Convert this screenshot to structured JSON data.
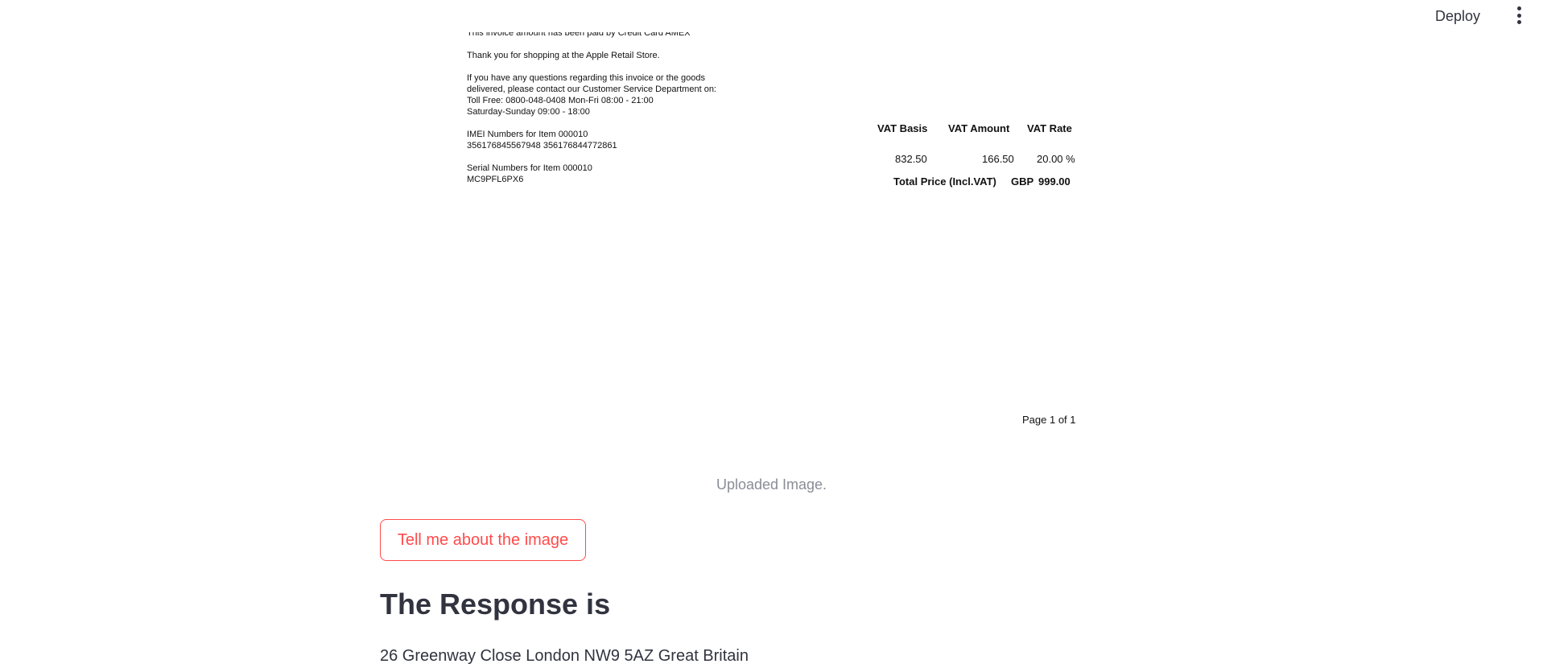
{
  "header": {
    "deploy_label": "Deploy",
    "menu_icon": "vertical-ellipsis-icon"
  },
  "invoice": {
    "notes": [
      "This invoice amount has been paid by Credit Card AMEX",
      "Thank you for shopping at the Apple Retail Store.",
      "If you have any questions regarding this invoice or the goods\ndelivered, please contact our Customer Service Department on:\nToll Free: 0800-048-0408 Mon-Fri 08:00 - 21:00\nSaturday-Sunday 09:00 - 18:00",
      "IMEI Numbers for Item 000010\n356176845567948 356176844772861",
      "Serial Numbers for Item 000010\nMC9PFL6PX6"
    ],
    "vat": {
      "headers": [
        "VAT Basis",
        "VAT Amount",
        "VAT Rate"
      ],
      "values": [
        "832.50",
        "166.50",
        "20.00 %"
      ],
      "total_label": "Total Price (Incl.VAT)",
      "currency": "GBP",
      "total_value": "999.00"
    },
    "page_label": "Page 1 of 1"
  },
  "caption": "Uploaded Image.",
  "button_label": "Tell me about the image",
  "response_heading": "The Response is",
  "response_text": "26 Greenway Close London NW9 5AZ Great Britain",
  "colors": {
    "accent": "#ff4b4b",
    "text": "#31333f",
    "caption": "#8a8d96"
  }
}
